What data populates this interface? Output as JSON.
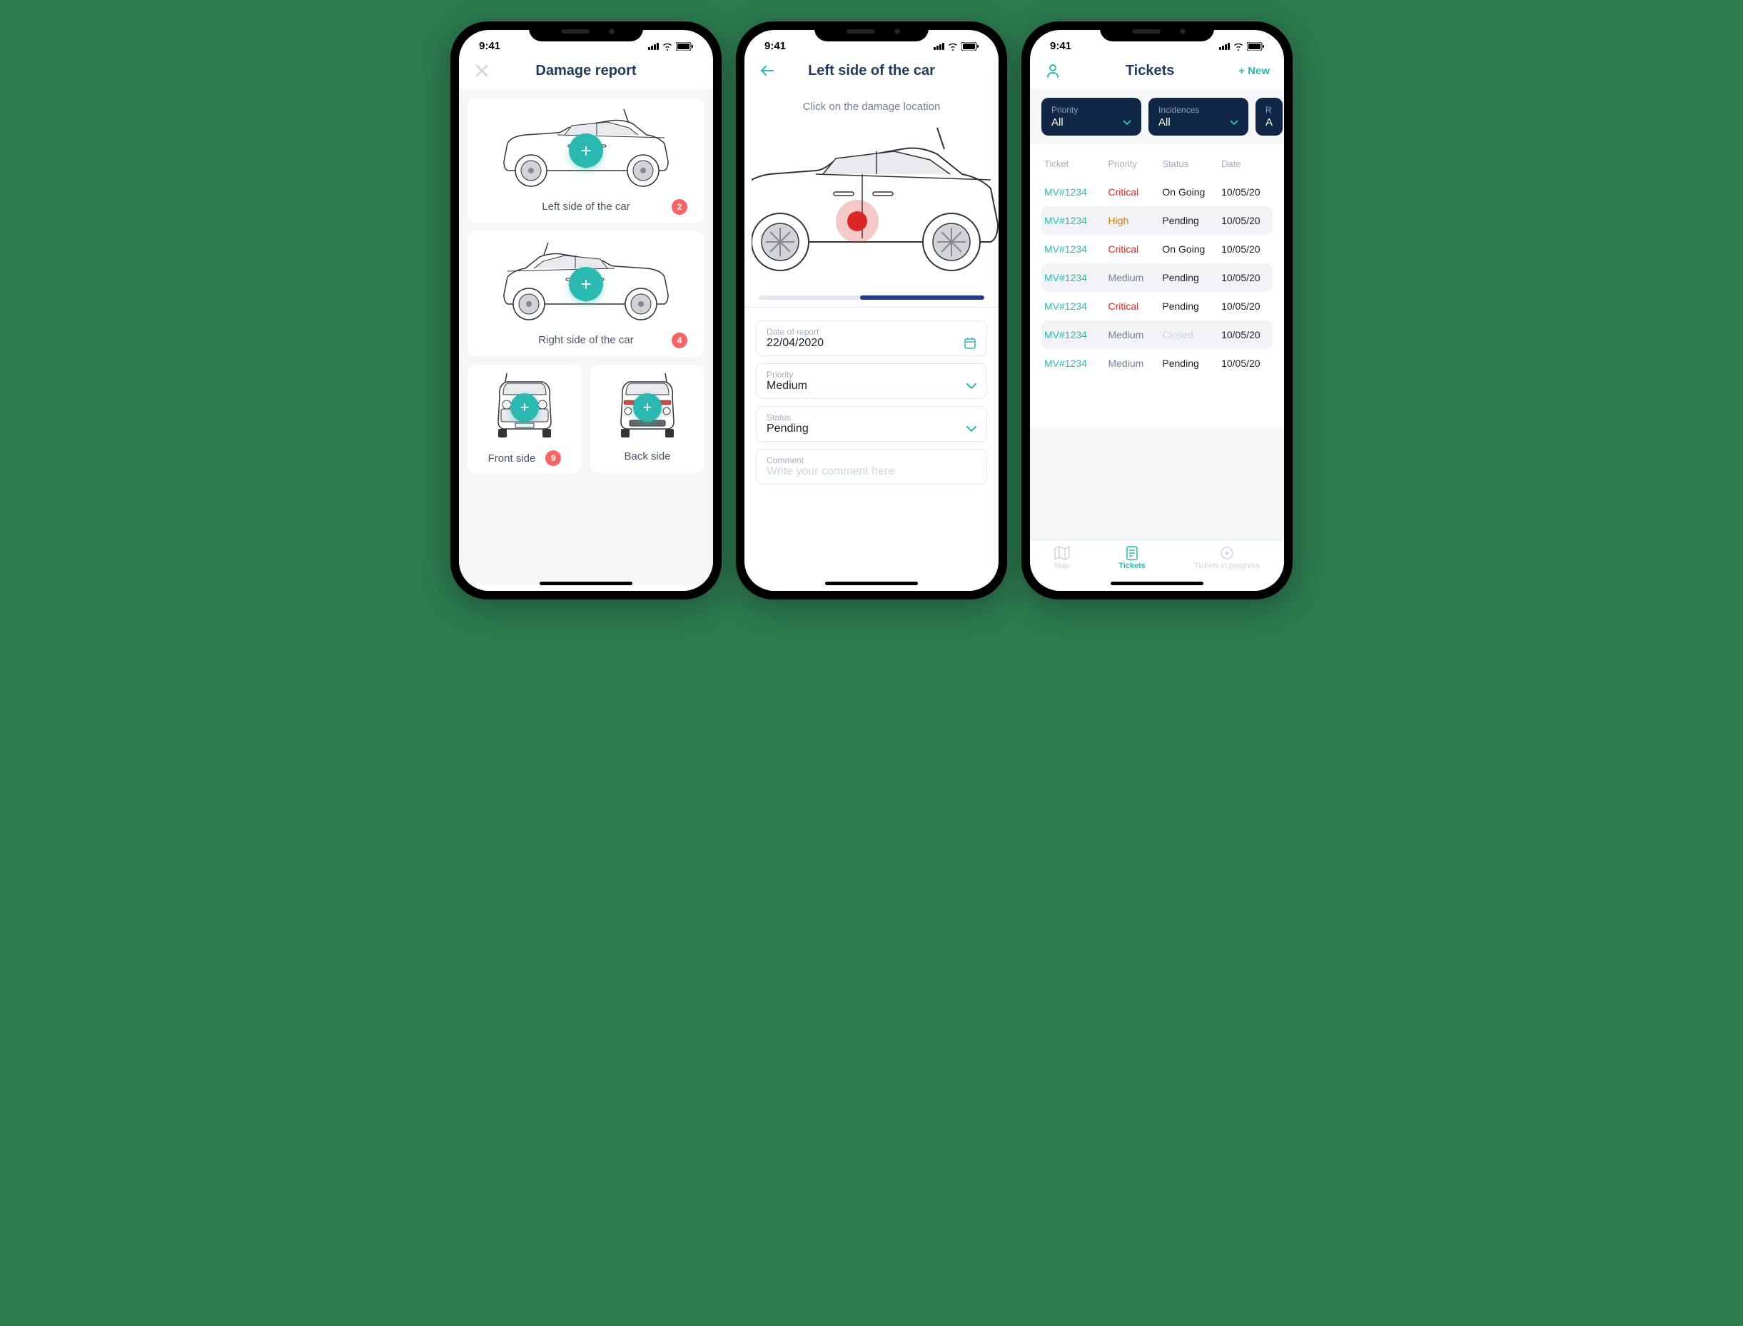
{
  "status_time": "9:41",
  "screen1": {
    "title": "Damage report",
    "cards": [
      {
        "label": "Left side of the car",
        "count": "2"
      },
      {
        "label": "Right side of the car",
        "count": "4"
      },
      {
        "label": "Front side",
        "count": "9"
      },
      {
        "label": "Back side",
        "count": null
      }
    ]
  },
  "screen2": {
    "title": "Left side of the car",
    "instruction": "Click on the damage location",
    "fields": {
      "date_label": "Date of report",
      "date_value": "22/04/2020",
      "priority_label": "Priority",
      "priority_value": "Medium",
      "status_label": "Status",
      "status_value": "Pending",
      "comment_label": "Comment",
      "comment_placeholder": "Write your comment here"
    }
  },
  "screen3": {
    "title": "Tickets",
    "new_label": "+ New",
    "filters": [
      {
        "label": "Priority",
        "value": "All"
      },
      {
        "label": "Incidences",
        "value": "All"
      },
      {
        "label": "R",
        "value": "A"
      }
    ],
    "columns": {
      "c1": "Ticket",
      "c2": "Priority",
      "c3": "Status",
      "c4": "Date"
    },
    "rows": [
      {
        "id": "MV#1234",
        "priority": "Critical",
        "status": "On Going",
        "date": "10/05/20"
      },
      {
        "id": "MV#1234",
        "priority": "High",
        "status": "Pending",
        "date": "10/05/20"
      },
      {
        "id": "MV#1234",
        "priority": "Critical",
        "status": "On Going",
        "date": "10/05/20"
      },
      {
        "id": "MV#1234",
        "priority": "Medium",
        "status": "Pending",
        "date": "10/05/20"
      },
      {
        "id": "MV#1234",
        "priority": "Critical",
        "status": "Pending",
        "date": "10/05/20"
      },
      {
        "id": "MV#1234",
        "priority": "Medium",
        "status": "Closed",
        "date": "10/05/20"
      },
      {
        "id": "MV#1234",
        "priority": "Medium",
        "status": "Pending",
        "date": "10/05/20"
      }
    ],
    "tabs": {
      "map": "Map",
      "tickets": "Tickets",
      "progress": "Tickets in progress"
    }
  }
}
